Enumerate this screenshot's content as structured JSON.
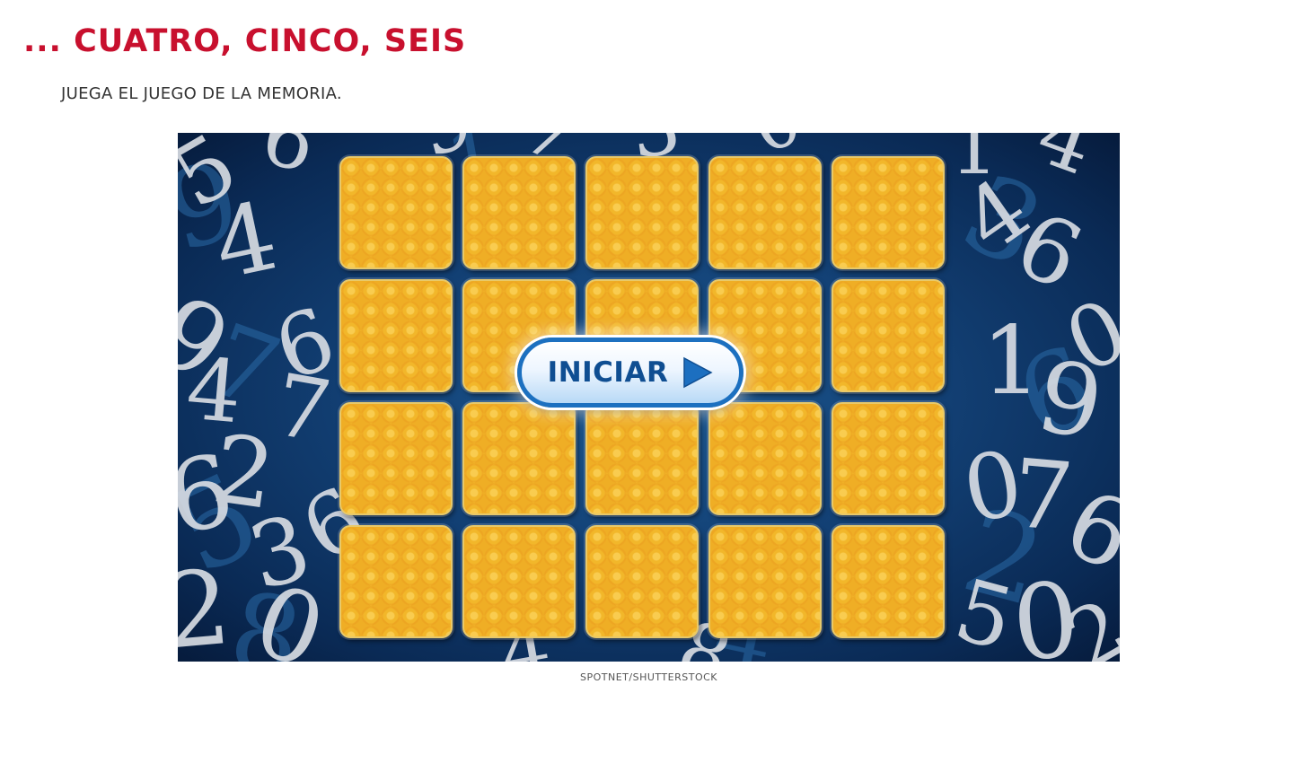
{
  "header": {
    "title": "... CUATRO, CINCO, SEIS",
    "instruction": "JUEGA EL JUEGO DE LA MEMORIA."
  },
  "game": {
    "grid": {
      "rows": 4,
      "columns": 5
    },
    "cards_state": "face-down",
    "card_color": "#f2b72a",
    "background_color": "#123f73",
    "start_button": {
      "label": "INICIAR",
      "icon": "play-icon"
    }
  },
  "credit": "SPOTNET/SHUTTERSTOCK",
  "colors": {
    "title": "#c8102e",
    "button_border": "#1c70c0",
    "button_text": "#0f4e92"
  }
}
